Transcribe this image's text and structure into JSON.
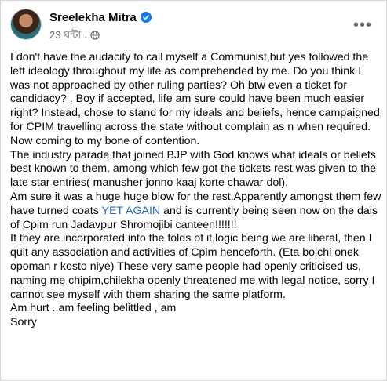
{
  "post": {
    "author": "Sreelekha Mitra",
    "time": "23 ঘন্টা",
    "dot": "·",
    "icons": {
      "verified": "verified-badge-icon",
      "audience": "globe-icon",
      "menu": "more-options-icon"
    },
    "paragraph1": "I don't have the audacity to call myself a Communist,but yes followed the left ideology throughout my life as comprehended by me. Do you think I was not approached by other ruling parties? Oh btw even a ticket for candidacy? . Boy if accepted, life am sure could have been much easier right? Instead, chose to stand for my ideals and beliefs, hence campaigned for CPIM travelling across the state without complain as n when required.",
    "paragraph2": "Now coming to my bone of contention.",
    "paragraph3": "The industry parade that joined BJP with God knows what ideals or beliefs best known to them, among which few got the tickets rest was given to the late star entries( manusher jonno kaaj korte chawar dol).",
    "paragraph4a": "Am sure it was a huge huge blow for the rest.Apparently amongst them few have turned coats ",
    "paragraph4_highlight": "YET AGAIN",
    "paragraph4b": " and is currently being seen now on the dais of Cpim run Jadavpur Shromojibi canteen!!!!!!!",
    "paragraph5": "If they are incorporated into the folds of it,logic being we are liberal, then I quit any association and activities of Cpim henceforth. (Eta bolchi onek opoman r kosto niye)  These very same people had openly criticised us, naming me chipim,chilekha  openly threatened me with legal notice, sorry I cannot see myself with them sharing the same platform.",
    "paragraph6": "Am hurt ..am feeling belittled , am",
    "paragraph7": "Sorry"
  },
  "colors": {
    "link_highlight": "#1a6cd4",
    "verified": "#1877f2",
    "secondary_text": "#65676b"
  }
}
